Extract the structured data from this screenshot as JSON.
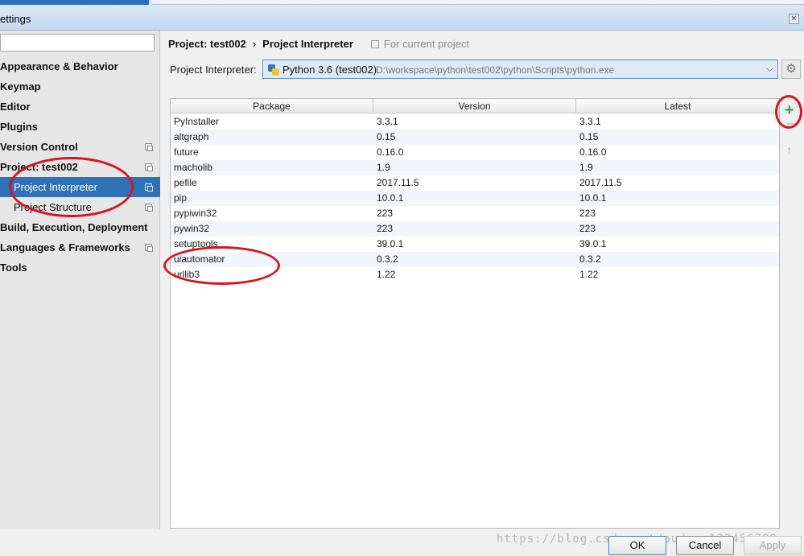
{
  "window": {
    "title": "ettings"
  },
  "sidebar": {
    "items": [
      {
        "label": "Appearance & Behavior",
        "bold": true,
        "icon": false
      },
      {
        "label": "Keymap",
        "bold": true,
        "icon": false
      },
      {
        "label": "Editor",
        "bold": true,
        "icon": false
      },
      {
        "label": "Plugins",
        "bold": true,
        "icon": false
      },
      {
        "label": "Version Control",
        "bold": true,
        "icon": true
      },
      {
        "label": "Project: test002",
        "bold": true,
        "icon": true
      },
      {
        "label": "Project Interpreter",
        "bold": false,
        "icon": true,
        "selected": true
      },
      {
        "label": "Project Structure",
        "bold": false,
        "icon": true
      },
      {
        "label": "Build, Execution, Deployment",
        "bold": true,
        "icon": false
      },
      {
        "label": "Languages & Frameworks",
        "bold": true,
        "icon": true
      },
      {
        "label": "Tools",
        "bold": true,
        "icon": false
      }
    ]
  },
  "breadcrumb": {
    "project": "Project: test002",
    "separator": "›",
    "page": "Project Interpreter",
    "scope": "For current project"
  },
  "interpreter": {
    "label": "Project Interpreter:",
    "name": "Python 3.6 (test002)",
    "path": "D:\\workspace\\python\\test002\\python\\Scripts\\python.exe"
  },
  "packages": {
    "columns": [
      "Package",
      "Version",
      "Latest"
    ],
    "rows": [
      [
        "PyInstaller",
        "3.3.1",
        "3.3.1"
      ],
      [
        "altgraph",
        "0.15",
        "0.15"
      ],
      [
        "future",
        "0.16.0",
        "0.16.0"
      ],
      [
        "macholib",
        "1.9",
        "1.9"
      ],
      [
        "pefile",
        "2017.11.5",
        "2017.11.5"
      ],
      [
        "pip",
        "10.0.1",
        "10.0.1"
      ],
      [
        "pypiwin32",
        "223",
        "223"
      ],
      [
        "pywin32",
        "223",
        "223"
      ],
      [
        "setuptools",
        "39.0.1",
        "39.0.1"
      ],
      [
        "uiautomator",
        "0.3.2",
        "0.3.2"
      ],
      [
        "urllib3",
        "1.22",
        "1.22"
      ]
    ]
  },
  "tools": {
    "add": "+",
    "up": "↑"
  },
  "footer": {
    "ok": "OK",
    "cancel": "Cancel",
    "apply": "Apply"
  },
  "watermark": "https://blog.csdn.net/pudung123456789",
  "colors": {
    "selection": "#2f71b6",
    "annotation": "#d9141d",
    "add_icon": "#2ea44f"
  }
}
